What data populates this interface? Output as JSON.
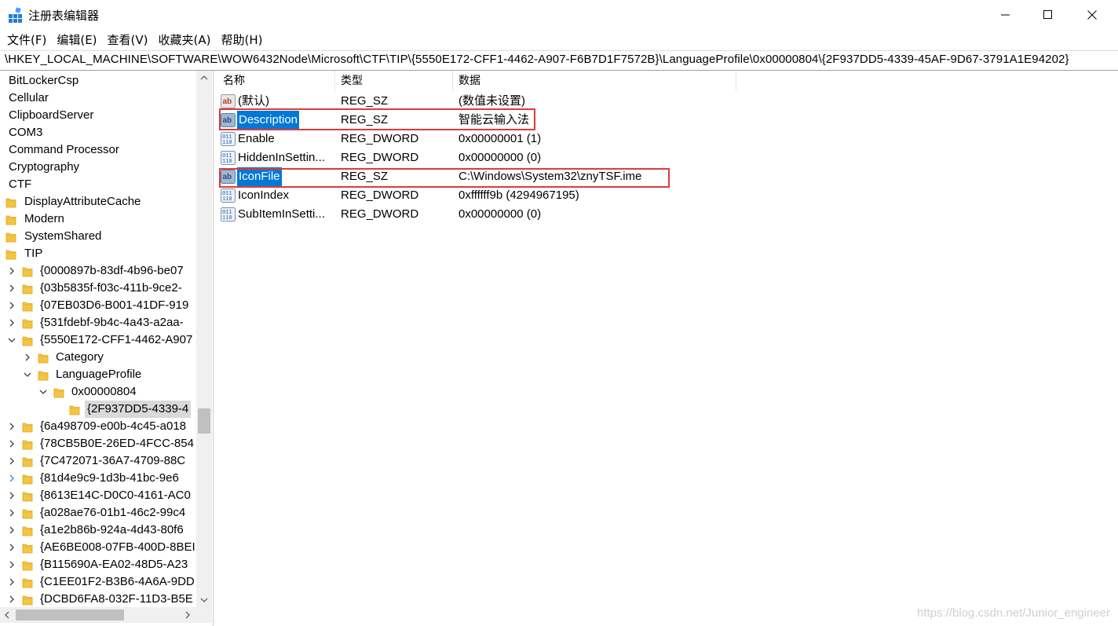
{
  "window": {
    "title": "注册表编辑器",
    "icon": "regedit-icon"
  },
  "menu": [
    "文件(F)",
    "编辑(E)",
    "查看(V)",
    "收藏夹(A)",
    "帮助(H)"
  ],
  "address": "\\HKEY_LOCAL_MACHINE\\SOFTWARE\\WOW6432Node\\Microsoft\\CTF\\TIP\\{5550E172-CFF1-4462-A907-F6B7D1F7572B}\\LanguageProfile\\0x00000804\\{2F937DD5-4339-45AF-9D67-3791A1E94202}",
  "tree": {
    "rows": [
      {
        "label": "BitLockerCsp",
        "level": 0,
        "expander": "none",
        "folder": false
      },
      {
        "label": "Cellular",
        "level": 0,
        "expander": "none",
        "folder": false
      },
      {
        "label": "ClipboardServer",
        "level": 0,
        "expander": "none",
        "folder": false
      },
      {
        "label": "COM3",
        "level": 0,
        "expander": "none",
        "folder": false
      },
      {
        "label": "Command Processor",
        "level": 0,
        "expander": "none",
        "folder": false
      },
      {
        "label": "Cryptography",
        "level": 0,
        "expander": "none",
        "folder": false
      },
      {
        "label": "CTF",
        "level": 0,
        "expander": "none",
        "folder": false
      },
      {
        "label": "DisplayAttributeCache",
        "level": 1,
        "expander": "none",
        "folder": true
      },
      {
        "label": "Modern",
        "level": 1,
        "expander": "none",
        "folder": true
      },
      {
        "label": "SystemShared",
        "level": 1,
        "expander": "none",
        "folder": true
      },
      {
        "label": "TIP",
        "level": 1,
        "expander": "none",
        "folder": true
      },
      {
        "label": "{0000897b-83df-4b96-be07",
        "level": 2,
        "expander": "collapsed",
        "folder": true
      },
      {
        "label": "{03b5835f-f03c-411b-9ce2-",
        "level": 2,
        "expander": "collapsed",
        "folder": true
      },
      {
        "label": "{07EB03D6-B001-41DF-919",
        "level": 2,
        "expander": "collapsed",
        "folder": true
      },
      {
        "label": "{531fdebf-9b4c-4a43-a2aa-",
        "level": 2,
        "expander": "collapsed",
        "folder": true
      },
      {
        "label": "{5550E172-CFF1-4462-A907",
        "level": 2,
        "expander": "expanded",
        "folder": true
      },
      {
        "label": "Category",
        "level": 3,
        "expander": "collapsed",
        "folder": true
      },
      {
        "label": "LanguageProfile",
        "level": 3,
        "expander": "expanded",
        "folder": true
      },
      {
        "label": "0x00000804",
        "level": 4,
        "expander": "expanded",
        "folder": true
      },
      {
        "label": "{2F937DD5-4339-4",
        "level": 5,
        "expander": "none",
        "folder": true,
        "selected": true
      },
      {
        "label": "{6a498709-e00b-4c45-a018",
        "level": 2,
        "expander": "collapsed",
        "folder": true
      },
      {
        "label": "{78CB5B0E-26ED-4FCC-854",
        "level": 2,
        "expander": "collapsed",
        "folder": true
      },
      {
        "label": "{7C472071-36A7-4709-88C",
        "level": 2,
        "expander": "collapsed",
        "folder": true
      },
      {
        "label": "{81d4e9c9-1d3b-41bc-9e6",
        "level": 2,
        "expander": "collapsed-hover",
        "folder": true
      },
      {
        "label": "{8613E14C-D0C0-4161-AC0",
        "level": 2,
        "expander": "collapsed",
        "folder": true
      },
      {
        "label": "{a028ae76-01b1-46c2-99c4",
        "level": 2,
        "expander": "collapsed",
        "folder": true
      },
      {
        "label": "{a1e2b86b-924a-4d43-80f6",
        "level": 2,
        "expander": "collapsed",
        "folder": true
      },
      {
        "label": "{AE6BE008-07FB-400D-8BEI",
        "level": 2,
        "expander": "collapsed",
        "folder": true
      },
      {
        "label": "{B115690A-EA02-48D5-A23",
        "level": 2,
        "expander": "collapsed",
        "folder": true
      },
      {
        "label": "{C1EE01F2-B3B6-4A6A-9DD",
        "level": 2,
        "expander": "collapsed",
        "folder": true
      },
      {
        "label": "{DCBD6FA8-032F-11D3-B5E",
        "level": 2,
        "expander": "collapsed",
        "folder": true
      }
    ]
  },
  "columns": {
    "name": "名称",
    "type": "类型",
    "data": "数据"
  },
  "values": [
    {
      "name": "(默认)",
      "type": "REG_SZ",
      "data": "(数值未设置)",
      "icon": "string-value-icon",
      "selected": false
    },
    {
      "name": "Description",
      "type": "REG_SZ",
      "data": "智能云输入法",
      "icon": "string-value-icon",
      "selected": true,
      "highlighted": true
    },
    {
      "name": "Enable",
      "type": "REG_DWORD",
      "data": "0x00000001 (1)",
      "icon": "binary-value-icon",
      "selected": false
    },
    {
      "name": "HiddenInSettin...",
      "type": "REG_DWORD",
      "data": "0x00000000 (0)",
      "icon": "binary-value-icon",
      "selected": false
    },
    {
      "name": "IconFile",
      "type": "REG_SZ",
      "data": "C:\\Windows\\System32\\znyTSF.ime",
      "icon": "string-value-icon",
      "selected": true,
      "highlighted": true
    },
    {
      "name": "IconIndex",
      "type": "REG_DWORD",
      "data": "0xffffff9b (4294967195)",
      "icon": "binary-value-icon",
      "selected": false
    },
    {
      "name": "SubItemInSetti...",
      "type": "REG_DWORD",
      "data": "0x00000000 (0)",
      "icon": "binary-value-icon",
      "selected": false
    }
  ],
  "colors": {
    "selection": "#0078d7",
    "highlight_box": "#e03a3a",
    "folder": "#f5c542"
  },
  "watermark": "https://blog.csdn.net/Junior_engineer"
}
